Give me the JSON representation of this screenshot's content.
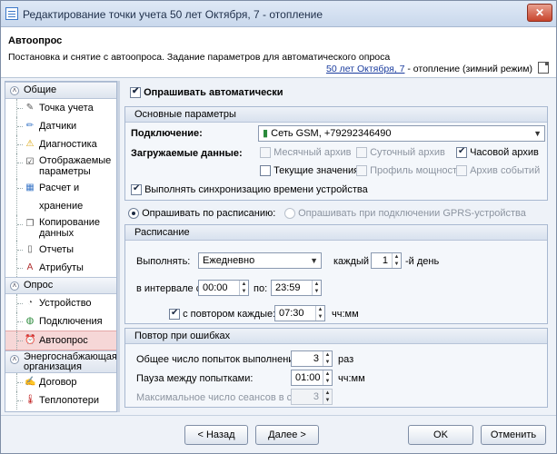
{
  "window": {
    "title": "Редактирование точки учета 50 лет Октября, 7 - отопление",
    "close_label": "✕"
  },
  "header": {
    "title": "Автоопрос",
    "description": "Постановка и снятие с автоопроса. Задание параметров для автоматического опроса",
    "link_text": "50 лет Октября, 7",
    "link_suffix": " - отопление (зимний режим)"
  },
  "sidebar": {
    "sections": [
      {
        "label": "Общие",
        "items": [
          "Точка учета",
          "Датчики",
          "Диагностика",
          "Отображаемые параметры",
          "Расчет и хранение",
          "Копирование данных",
          "Отчеты",
          "Атрибуты"
        ]
      },
      {
        "label": "Опрос",
        "items": [
          "Устройство",
          "Подключения",
          "Автоопрос"
        ]
      },
      {
        "label": "Энергоснабжающая организация",
        "items": [
          "Договор",
          "Теплопотери"
        ]
      }
    ]
  },
  "form": {
    "auto_poll_label": "Опрашивать автоматически",
    "basic_group": "Основные параметры",
    "connection_label": "Подключение:",
    "connection_value": "Сеть GSM, +79292346490",
    "load_data_label": "Загружаемые данные:",
    "data_options": [
      "Месячный архив",
      "Суточный архив",
      "Часовой архив",
      "Текущие значения",
      "Профиль мощности",
      "Архив событий"
    ],
    "sync_label": "Выполнять синхронизацию времени устройства",
    "schedule_radio": "Опрашивать по расписанию:",
    "gprs_radio": "Опрашивать при подключении GPRS-устройства",
    "schedule_group": "Расписание",
    "execute_label": "Выполнять:",
    "execute_value": "Ежедневно",
    "every_label": "каждый",
    "every_value": "1",
    "day_suffix": "-й день",
    "interval_label": "в интервале с:",
    "interval_from": "00:00",
    "interval_to_label": "по:",
    "interval_to": "23:59",
    "repeat_label": "с повтором каждые:",
    "repeat_value": "07:30",
    "repeat_unit": "чч:мм",
    "retry_group": "Повтор при ошибках",
    "attempts_label": "Общее число попыток выполнения:",
    "attempts_value": "3",
    "attempts_unit": "раз",
    "pause_label": "Пауза между попытками:",
    "pause_value": "01:00",
    "pause_unit": "чч:мм",
    "max_sessions_label": "Максимальное число сеансов в сутки:",
    "max_sessions_value": "3"
  },
  "footer": {
    "back": "< Назад",
    "next": "Далее >",
    "ok": "OK",
    "cancel": "Отменить"
  },
  "colors": {
    "accent": "#3c78c8",
    "active_item": "#f6d7d7",
    "link": "#1a3c9e"
  }
}
